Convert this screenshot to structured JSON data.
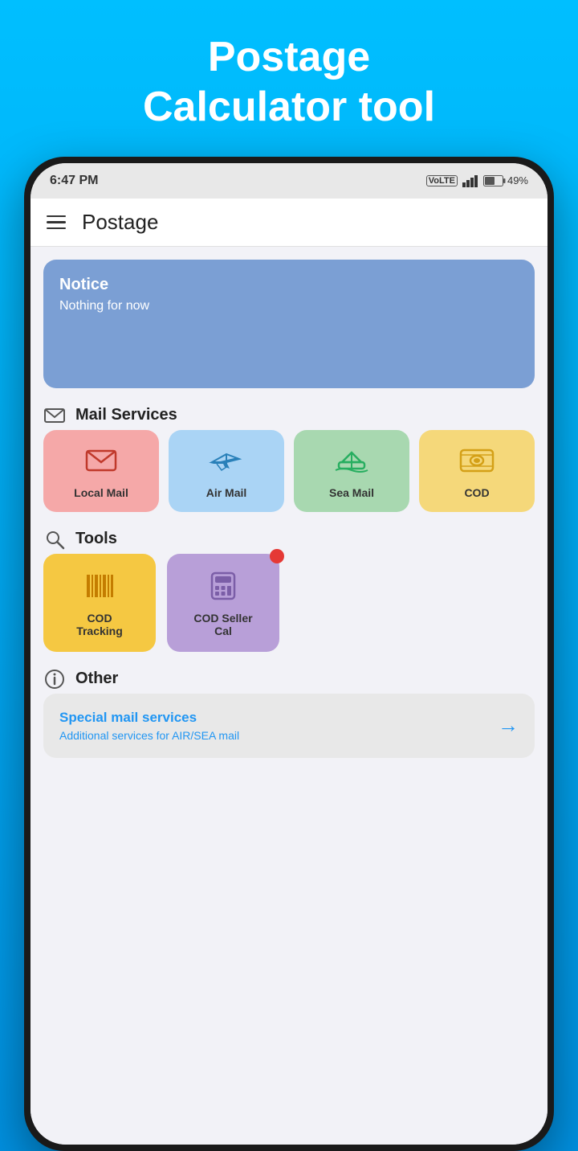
{
  "hero": {
    "title_line1": "Postage",
    "title_line2": "Calculator tool"
  },
  "status_bar": {
    "time": "6:47 PM",
    "signal": "▌▌▌",
    "battery_pct": "49%"
  },
  "header": {
    "title": "Postage",
    "hamburger_label": "menu"
  },
  "notice": {
    "title": "Notice",
    "body": "Nothing for now"
  },
  "mail_services": {
    "section_label": "Mail Services",
    "items": [
      {
        "id": "local-mail",
        "label": "Local Mail"
      },
      {
        "id": "air-mail",
        "label": "Air Mail"
      },
      {
        "id": "sea-mail",
        "label": "Sea Mail"
      },
      {
        "id": "cod",
        "label": "COD"
      }
    ]
  },
  "tools": {
    "section_label": "Tools",
    "items": [
      {
        "id": "cod-tracking",
        "label": "COD\nTracking",
        "has_badge": false
      },
      {
        "id": "cod-seller",
        "label": "COD Seller\nCal",
        "has_badge": true
      }
    ]
  },
  "other": {
    "section_label": "Other",
    "special_card": {
      "title": "Special mail services",
      "subtitle": "Additional services for AIR/SEA mail"
    }
  }
}
